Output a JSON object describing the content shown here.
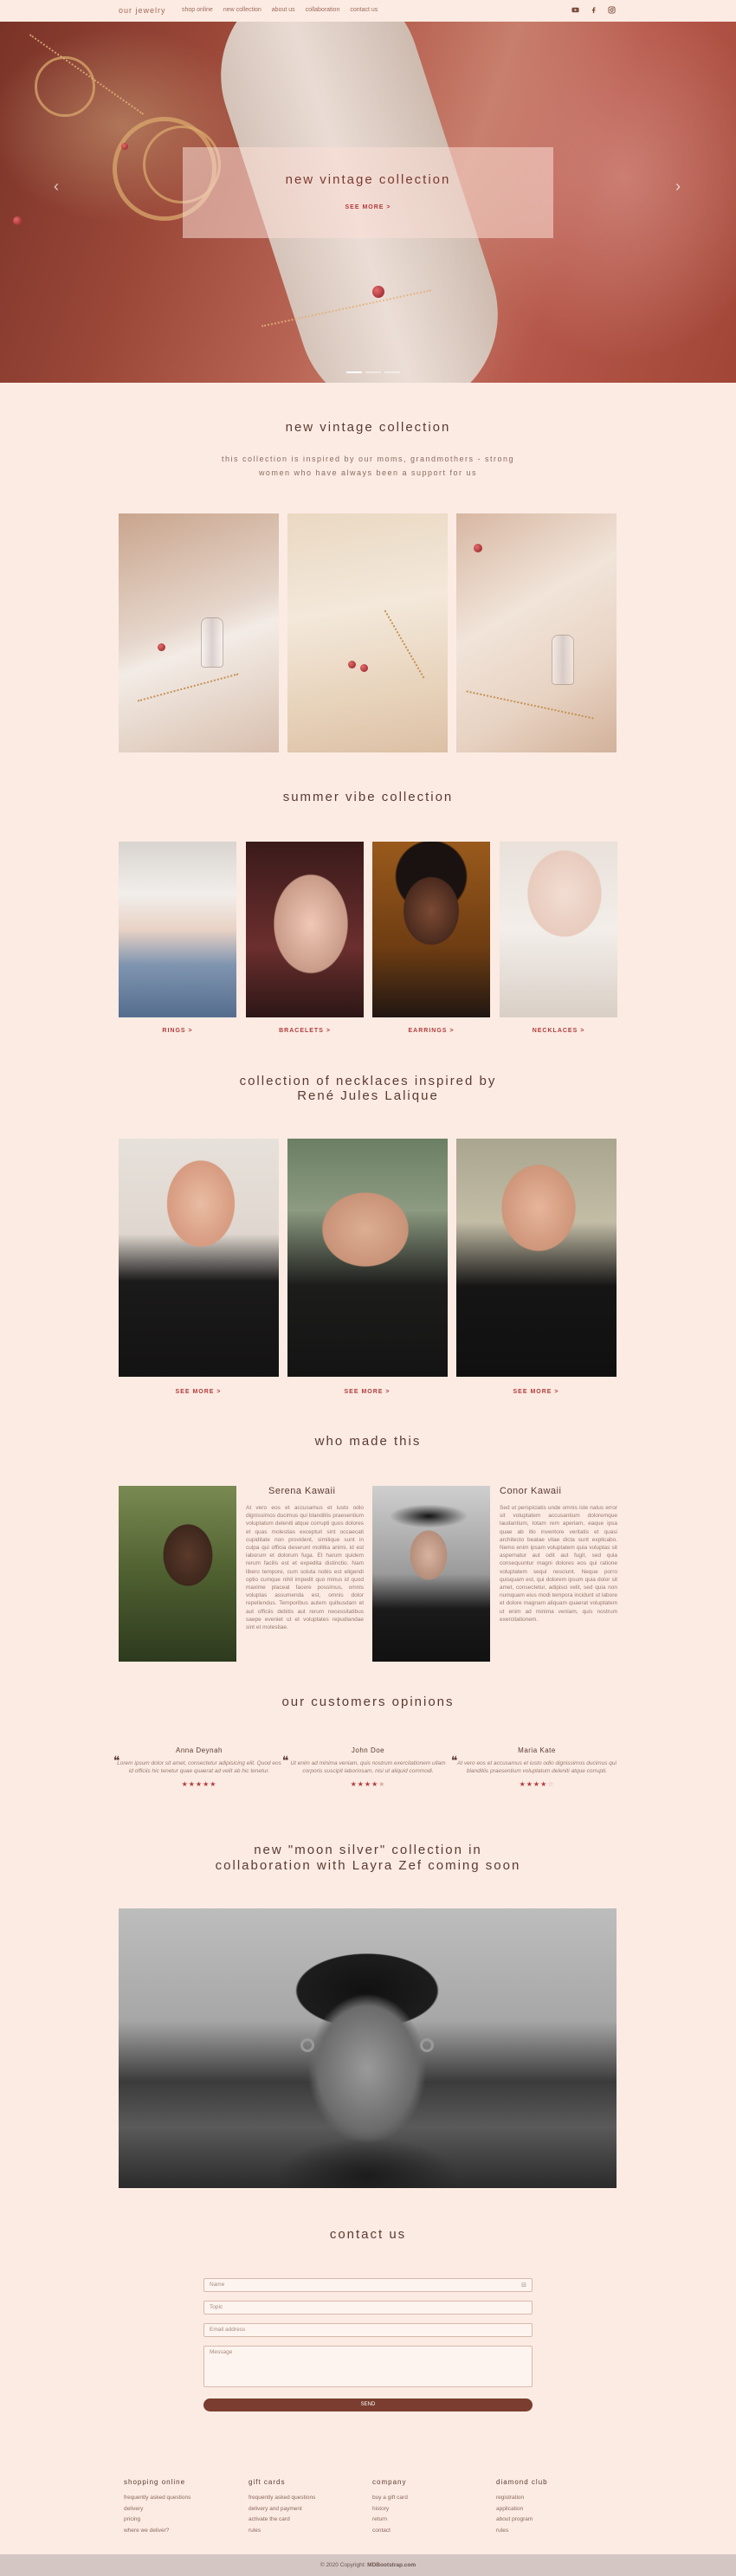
{
  "nav": {
    "brand": "our jewelry",
    "links": [
      "shop online",
      "new collection",
      "about us",
      "collaboration",
      "contact us"
    ],
    "social_icons": [
      "youtube-icon",
      "facebook-icon",
      "instagram-icon"
    ]
  },
  "hero": {
    "title": "new vintage collection",
    "button": "SEE MORE >",
    "prev_glyph": "‹",
    "next_glyph": "›"
  },
  "vintage": {
    "title": "new vintage collection",
    "subtitle_line1": "this collection is inspired by our moms, grandmothers - strong",
    "subtitle_line2": "women who have always been a support for us"
  },
  "summer": {
    "title": "summer vibe collection",
    "categories": [
      "RINGS >",
      "BRACELETS >",
      "EARRINGS >",
      "NECKLACES >"
    ]
  },
  "necklaces": {
    "title_line1": "collection of necklaces inspired by",
    "title_line2": "René Jules Lalique",
    "links": [
      "SEE MORE >",
      "SEE MORE >",
      "SEE MORE >"
    ]
  },
  "team": {
    "title": "who made this",
    "members": [
      {
        "name": "Serena Kawaii",
        "bio": "At vero eos et accusamus et iusto odio dignissimos ducimus qui blanditiis praesentium voluptatum deleniti atque corrupti quos dolores et quas molestias excepturi sint occaecati cupiditate non provident, similique sunt in culpa qui officia deserunt mollitia animi, id est laborum et dolorum fuga. Et harum quidem rerum facilis est et expedita distinctio. Nam libero tempore, cum soluta nobis est eligendi optio cumque nihil impedit quo minus id quod maxime placeat facere possimus, omnis voluptas assumenda est, omnis dolor repellendus. Temporibus autem quibusdam et aut officiis debitis aut rerum necessitatibus saepe eveniet ut et voluptates repudiandae sint et molestiae."
      },
      {
        "name": "Conor Kawaii",
        "bio": "Sed ut perspiciatis unde omnis iste natus error sit voluptatem accusantium doloremque laudantium, totam rem aperiam, eaque ipsa quae ab illo inventore veritatis et quasi architecto beatae vitae dicta sunt explicabo. Nemo enim ipsam voluptatem quia voluptas sit aspernatur aut odit aut fugit, sed quia consequuntur magni dolores eos qui ratione voluptatem sequi nesciunt. Neque porro quisquam est, qui dolorem ipsum quia dolor sit amet, consectetur, adipisci velit, sed quia non numquam eius modi tempora incidunt ut labore et dolore magnam aliquam quaerat voluptatem ut enim ad minima veniam, quis nostrum exercitationem."
      }
    ]
  },
  "opinions": {
    "title": "our customers opinions",
    "items": [
      {
        "name": "Anna Deynah",
        "text": "Lorem ipsum dolor sit amet, consectetur adipisicing elit. Quod eos id officiis hic tenetur quae quaerat ad velit ab hic tenetur.",
        "stars_on": "★★★★★",
        "stars_off": ""
      },
      {
        "name": "John Doe",
        "text": "Ut enim ad minima veniam, quis nostrum exercitationem ullam corporis suscipit laboriosam, nisi ut aliquid commodi.",
        "stars_on": "★★★★",
        "stars_off": "★"
      },
      {
        "name": "Maria Kate",
        "text": "At vero eos et accusamus et iusto odio dignissimos ducimus qui blanditiis praesentium voluptatum deleniti atque corrupti.",
        "stars_on": "★★★★",
        "stars_off": "☆"
      }
    ]
  },
  "coming_soon": {
    "title_line1": "new \"moon silver\" collection in",
    "title_line2": "collaboration with Layra Zef coming soon"
  },
  "contact": {
    "title": "contact us",
    "name_placeholder": "Name",
    "topic_placeholder": "Topic",
    "email_placeholder": "Email address",
    "message_placeholder": "Message",
    "send_label": "SEND"
  },
  "footer": {
    "columns": [
      {
        "title": "shopping online",
        "links": [
          "frequently asked questions",
          "delivery",
          "pricing",
          "where we deliver?"
        ]
      },
      {
        "title": "gift cards",
        "links": [
          "frequently asked questions",
          "delivery and payment",
          "activate the card",
          "rules"
        ]
      },
      {
        "title": "company",
        "links": [
          "buy a gift card",
          "history",
          "return",
          "contact"
        ]
      },
      {
        "title": "diamond club",
        "links": [
          "registration",
          "application",
          "about program",
          "rules"
        ]
      }
    ],
    "copyright_prefix": "© 2020 Copyright:",
    "copyright_link": "MDBootstrap.com"
  },
  "colors": {
    "page_bg": "#fbebe3",
    "accent_red": "#b33b3b",
    "button_brown": "#7a3d2f",
    "footer_bar": "#d3c6c3"
  }
}
